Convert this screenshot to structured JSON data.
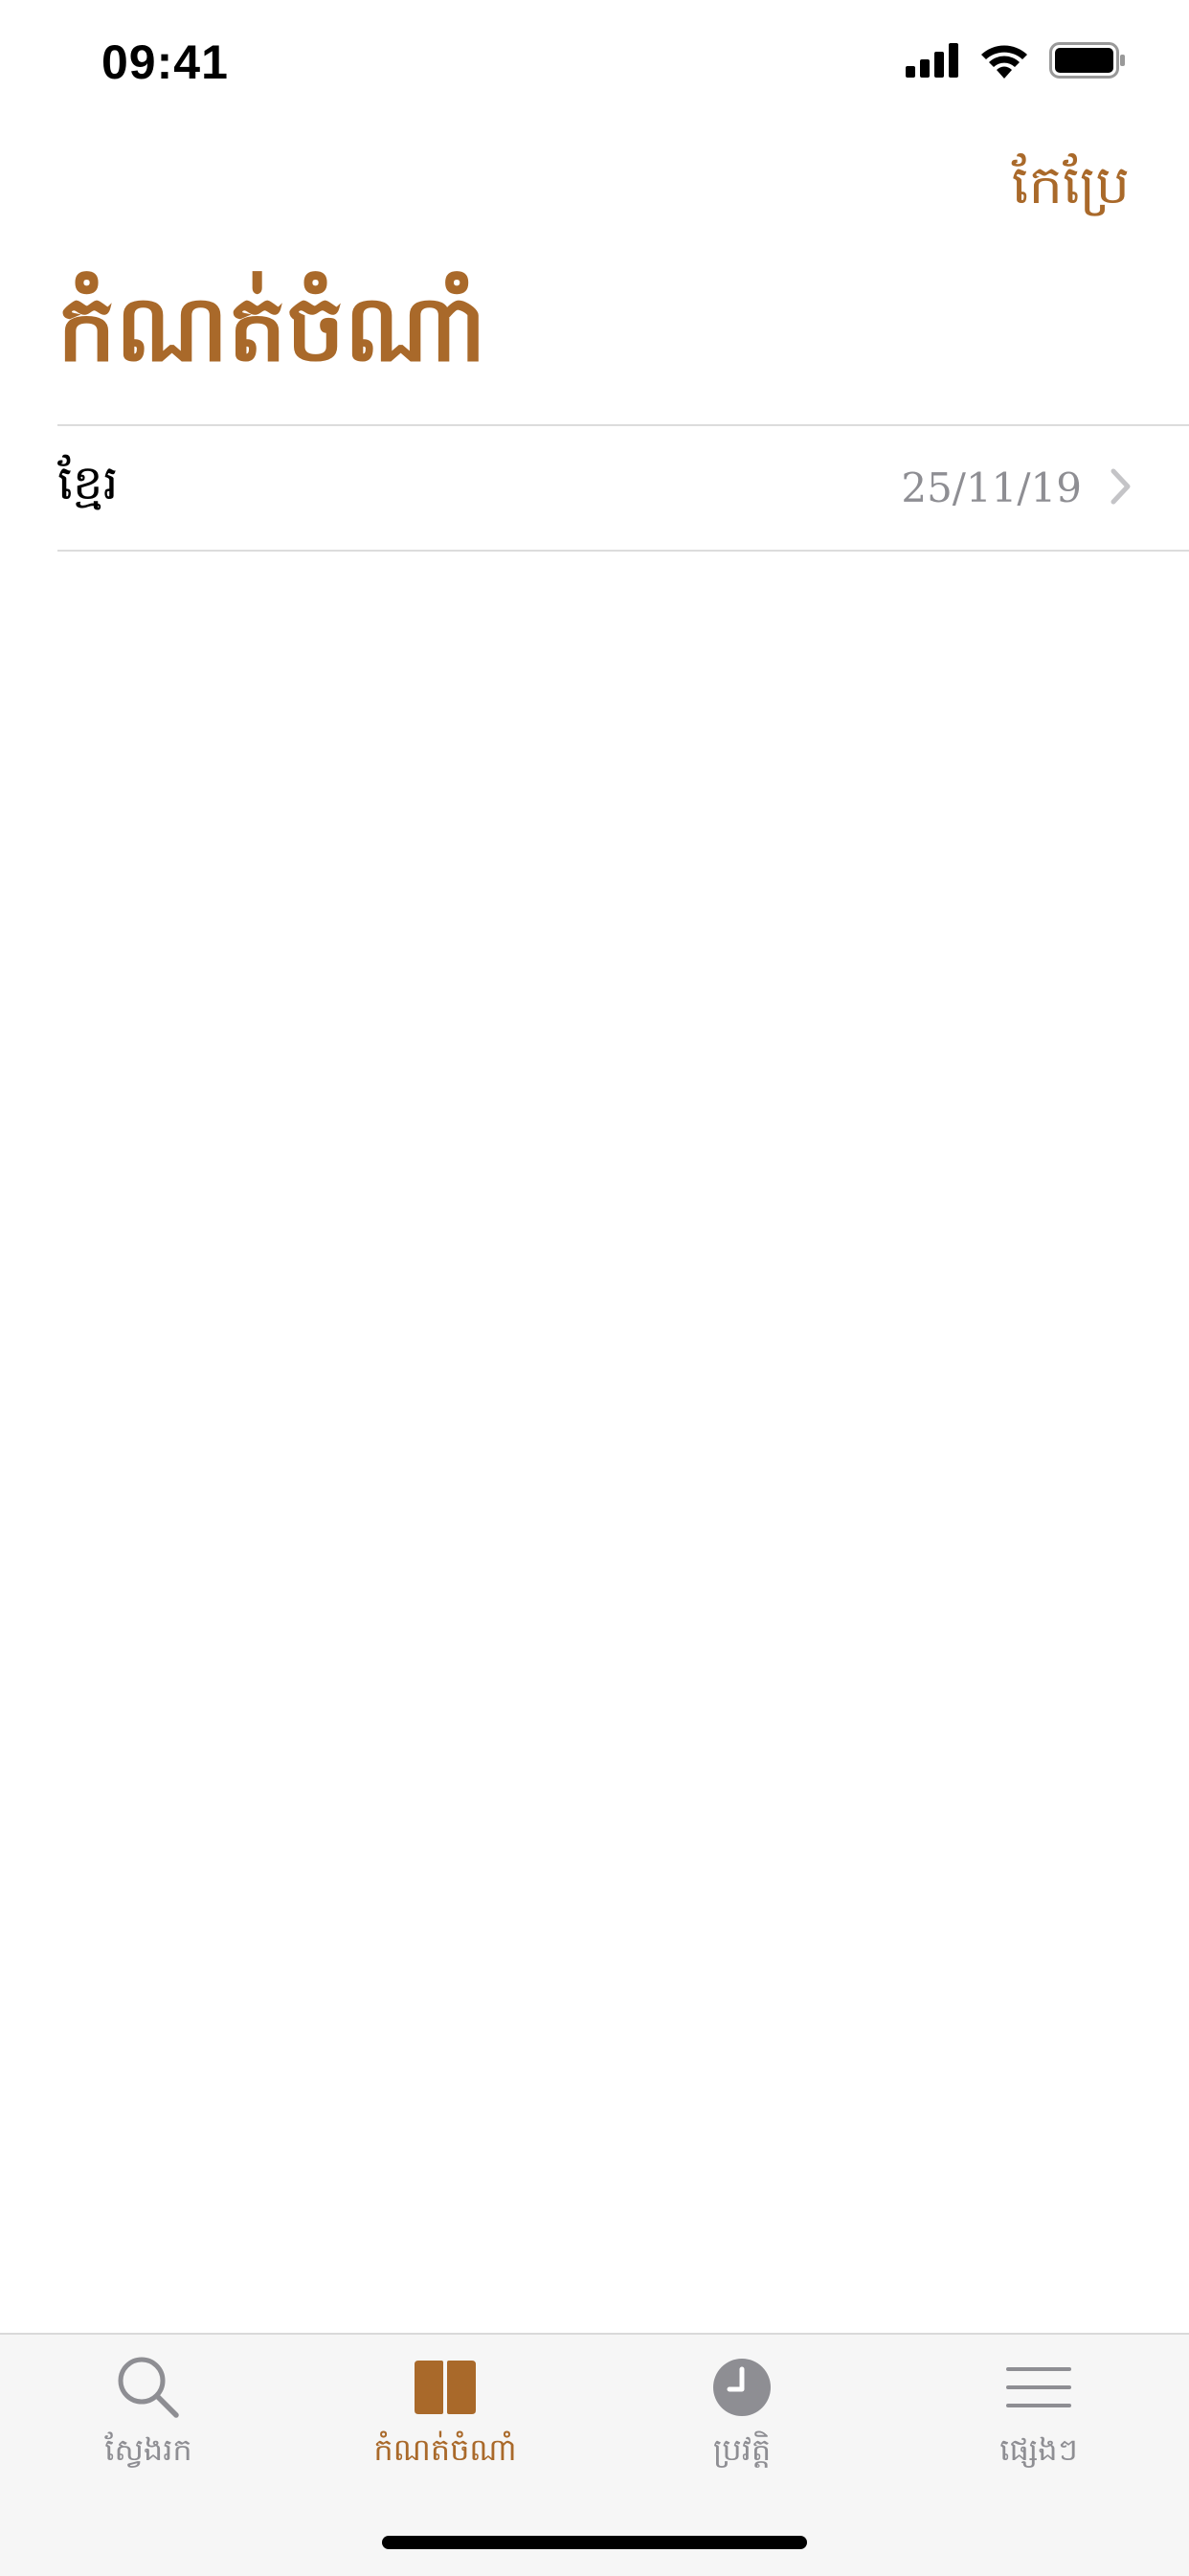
{
  "status_bar": {
    "time": "09:41"
  },
  "nav": {
    "edit_label": "កែប្រែ",
    "title": "កំណត់ចំណាំ"
  },
  "list": {
    "items": [
      {
        "title": "ខ្មែរ",
        "date": "25/11/19"
      }
    ]
  },
  "tab_bar": {
    "tabs": [
      {
        "label": "ស្វែងរក",
        "icon": "search-icon",
        "active": false
      },
      {
        "label": "កំណត់ចំណាំ",
        "icon": "book-icon",
        "active": true
      },
      {
        "label": "ប្រវត្តិ",
        "icon": "clock-icon",
        "active": false
      },
      {
        "label": "ផ្សេងៗ",
        "icon": "menu-icon",
        "active": false
      }
    ]
  },
  "colors": {
    "accent": "#A9692A",
    "inactive": "#8e8e93",
    "separator": "#dcdcdc"
  }
}
